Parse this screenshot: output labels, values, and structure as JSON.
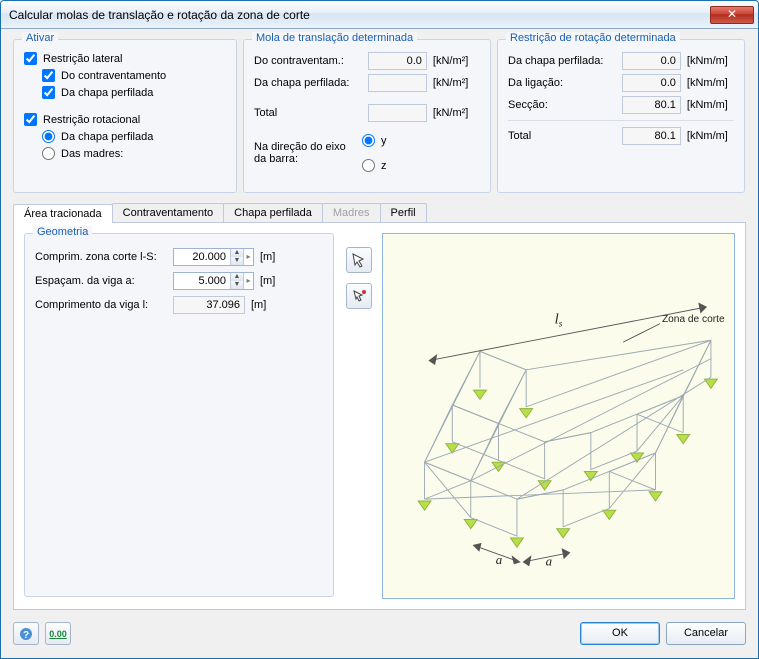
{
  "window": {
    "title": "Calcular molas de translação e rotação da zona de corte"
  },
  "activate": {
    "legend": "Ativar",
    "lateral_label": "Restrição lateral",
    "bracing_label": "Do contraventamento",
    "sheeting_label": "Da chapa perfilada",
    "rotational_label": "Restrição rotacional",
    "rot_sheeting_label": "Da chapa perfilada",
    "purlins_label": "Das madres:",
    "lateral_checked": true,
    "bracing_checked": true,
    "sheeting_checked": true,
    "rotational_checked": true,
    "rot_radio_selected": "sheeting"
  },
  "translation": {
    "legend": "Mola de translação determinada",
    "rows": [
      {
        "label": "Do contraventam.:",
        "value": "0.0",
        "unit": "[kN/m²]"
      },
      {
        "label": "Da chapa perfilada:",
        "value": "",
        "unit": "[kN/m²]"
      },
      {
        "label": "Total",
        "value": "",
        "unit": "[kN/m²]"
      }
    ],
    "dir_label": "Na direção do eixo da barra:",
    "dir_options": {
      "y": "y",
      "z": "z"
    },
    "dir_selected": "y"
  },
  "rotation": {
    "legend": "Restrição de rotação determinada",
    "rows": [
      {
        "label": "Da chapa perfilada:",
        "value": "0.0",
        "unit": "[kNm/m]"
      },
      {
        "label": "Da ligação:",
        "value": "0.0",
        "unit": "[kNm/m]"
      },
      {
        "label": "Secção:",
        "value": "80.1",
        "unit": "[kNm/m]"
      },
      {
        "label": "Total",
        "value": "80.1",
        "unit": "[kNm/m]"
      }
    ]
  },
  "tabs": [
    {
      "id": "area",
      "label": "Área tracionada",
      "active": true,
      "disabled": false
    },
    {
      "id": "bracing",
      "label": "Contraventamento",
      "active": false,
      "disabled": false
    },
    {
      "id": "sheet",
      "label": "Chapa perfilada",
      "active": false,
      "disabled": false
    },
    {
      "id": "purlins",
      "label": "Madres",
      "active": false,
      "disabled": true
    },
    {
      "id": "profile",
      "label": "Perfil",
      "active": false,
      "disabled": false
    }
  ],
  "geometry": {
    "legend": "Geometria",
    "ls_label": "Comprim. zona corte l-S:",
    "ls_value": "20.000",
    "a_label": "Espaçam. da viga a:",
    "a_value": "5.000",
    "l_label": "Comprimento da viga l:",
    "l_value": "37.096",
    "unit": "[m]"
  },
  "illustration": {
    "zone_label": "Zona de corte",
    "ls_symbol": "lₛ",
    "a_symbol": "a"
  },
  "buttons": {
    "ok": "OK",
    "cancel": "Cancelar"
  },
  "icons": {
    "help": "?",
    "units": "0.00"
  }
}
